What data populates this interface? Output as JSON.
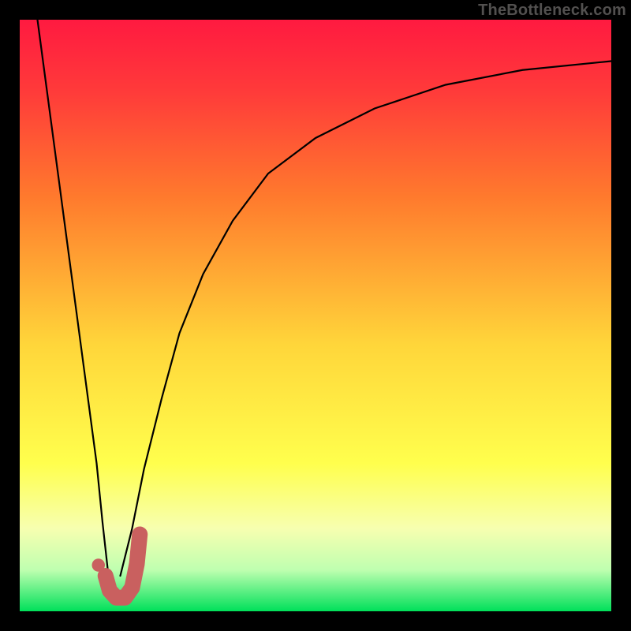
{
  "watermark": {
    "text": "TheBottleneck.com"
  },
  "palette": {
    "black": "#000000",
    "curve_black": "#000000",
    "marker": "#c9605f",
    "gradient_stops": [
      {
        "pct": 0,
        "color": "#ff1a40"
      },
      {
        "pct": 12,
        "color": "#ff3a3a"
      },
      {
        "pct": 30,
        "color": "#ff7a2d"
      },
      {
        "pct": 55,
        "color": "#ffd63a"
      },
      {
        "pct": 75,
        "color": "#ffff4d"
      },
      {
        "pct": 86,
        "color": "#f7ffb0"
      },
      {
        "pct": 93,
        "color": "#bfffb0"
      },
      {
        "pct": 100,
        "color": "#00e05a"
      }
    ]
  },
  "chart_data": {
    "type": "line",
    "title": "",
    "xlabel": "",
    "ylabel": "",
    "xlim": [
      0,
      100
    ],
    "ylim": [
      0,
      100
    ],
    "grid": false,
    "legend": false,
    "series": [
      {
        "name": "left-branch",
        "color": "#000000",
        "x": [
          3,
          5,
          7,
          9,
          11,
          13,
          14,
          15
        ],
        "y": [
          100,
          85,
          70,
          55,
          40,
          25,
          15,
          6
        ]
      },
      {
        "name": "right-branch",
        "color": "#000000",
        "x": [
          17,
          19,
          21,
          24,
          27,
          31,
          36,
          42,
          50,
          60,
          72,
          85,
          100
        ],
        "y": [
          6,
          14,
          24,
          36,
          47,
          57,
          66,
          74,
          80,
          85,
          89,
          91.5,
          93
        ]
      }
    ],
    "annotations": [
      {
        "name": "j-marker",
        "type": "path",
        "color": "#c9605f",
        "closed": false,
        "points_x": [
          14.5,
          15.2,
          16.3,
          17.8,
          19.0,
          19.8,
          20.3
        ],
        "points_y": [
          6.0,
          3.5,
          2.3,
          2.3,
          4.0,
          8.0,
          13.0
        ]
      },
      {
        "name": "j-dot",
        "type": "dot",
        "color": "#c9605f",
        "x": 13.3,
        "y": 7.8,
        "r": 1.1
      }
    ]
  }
}
